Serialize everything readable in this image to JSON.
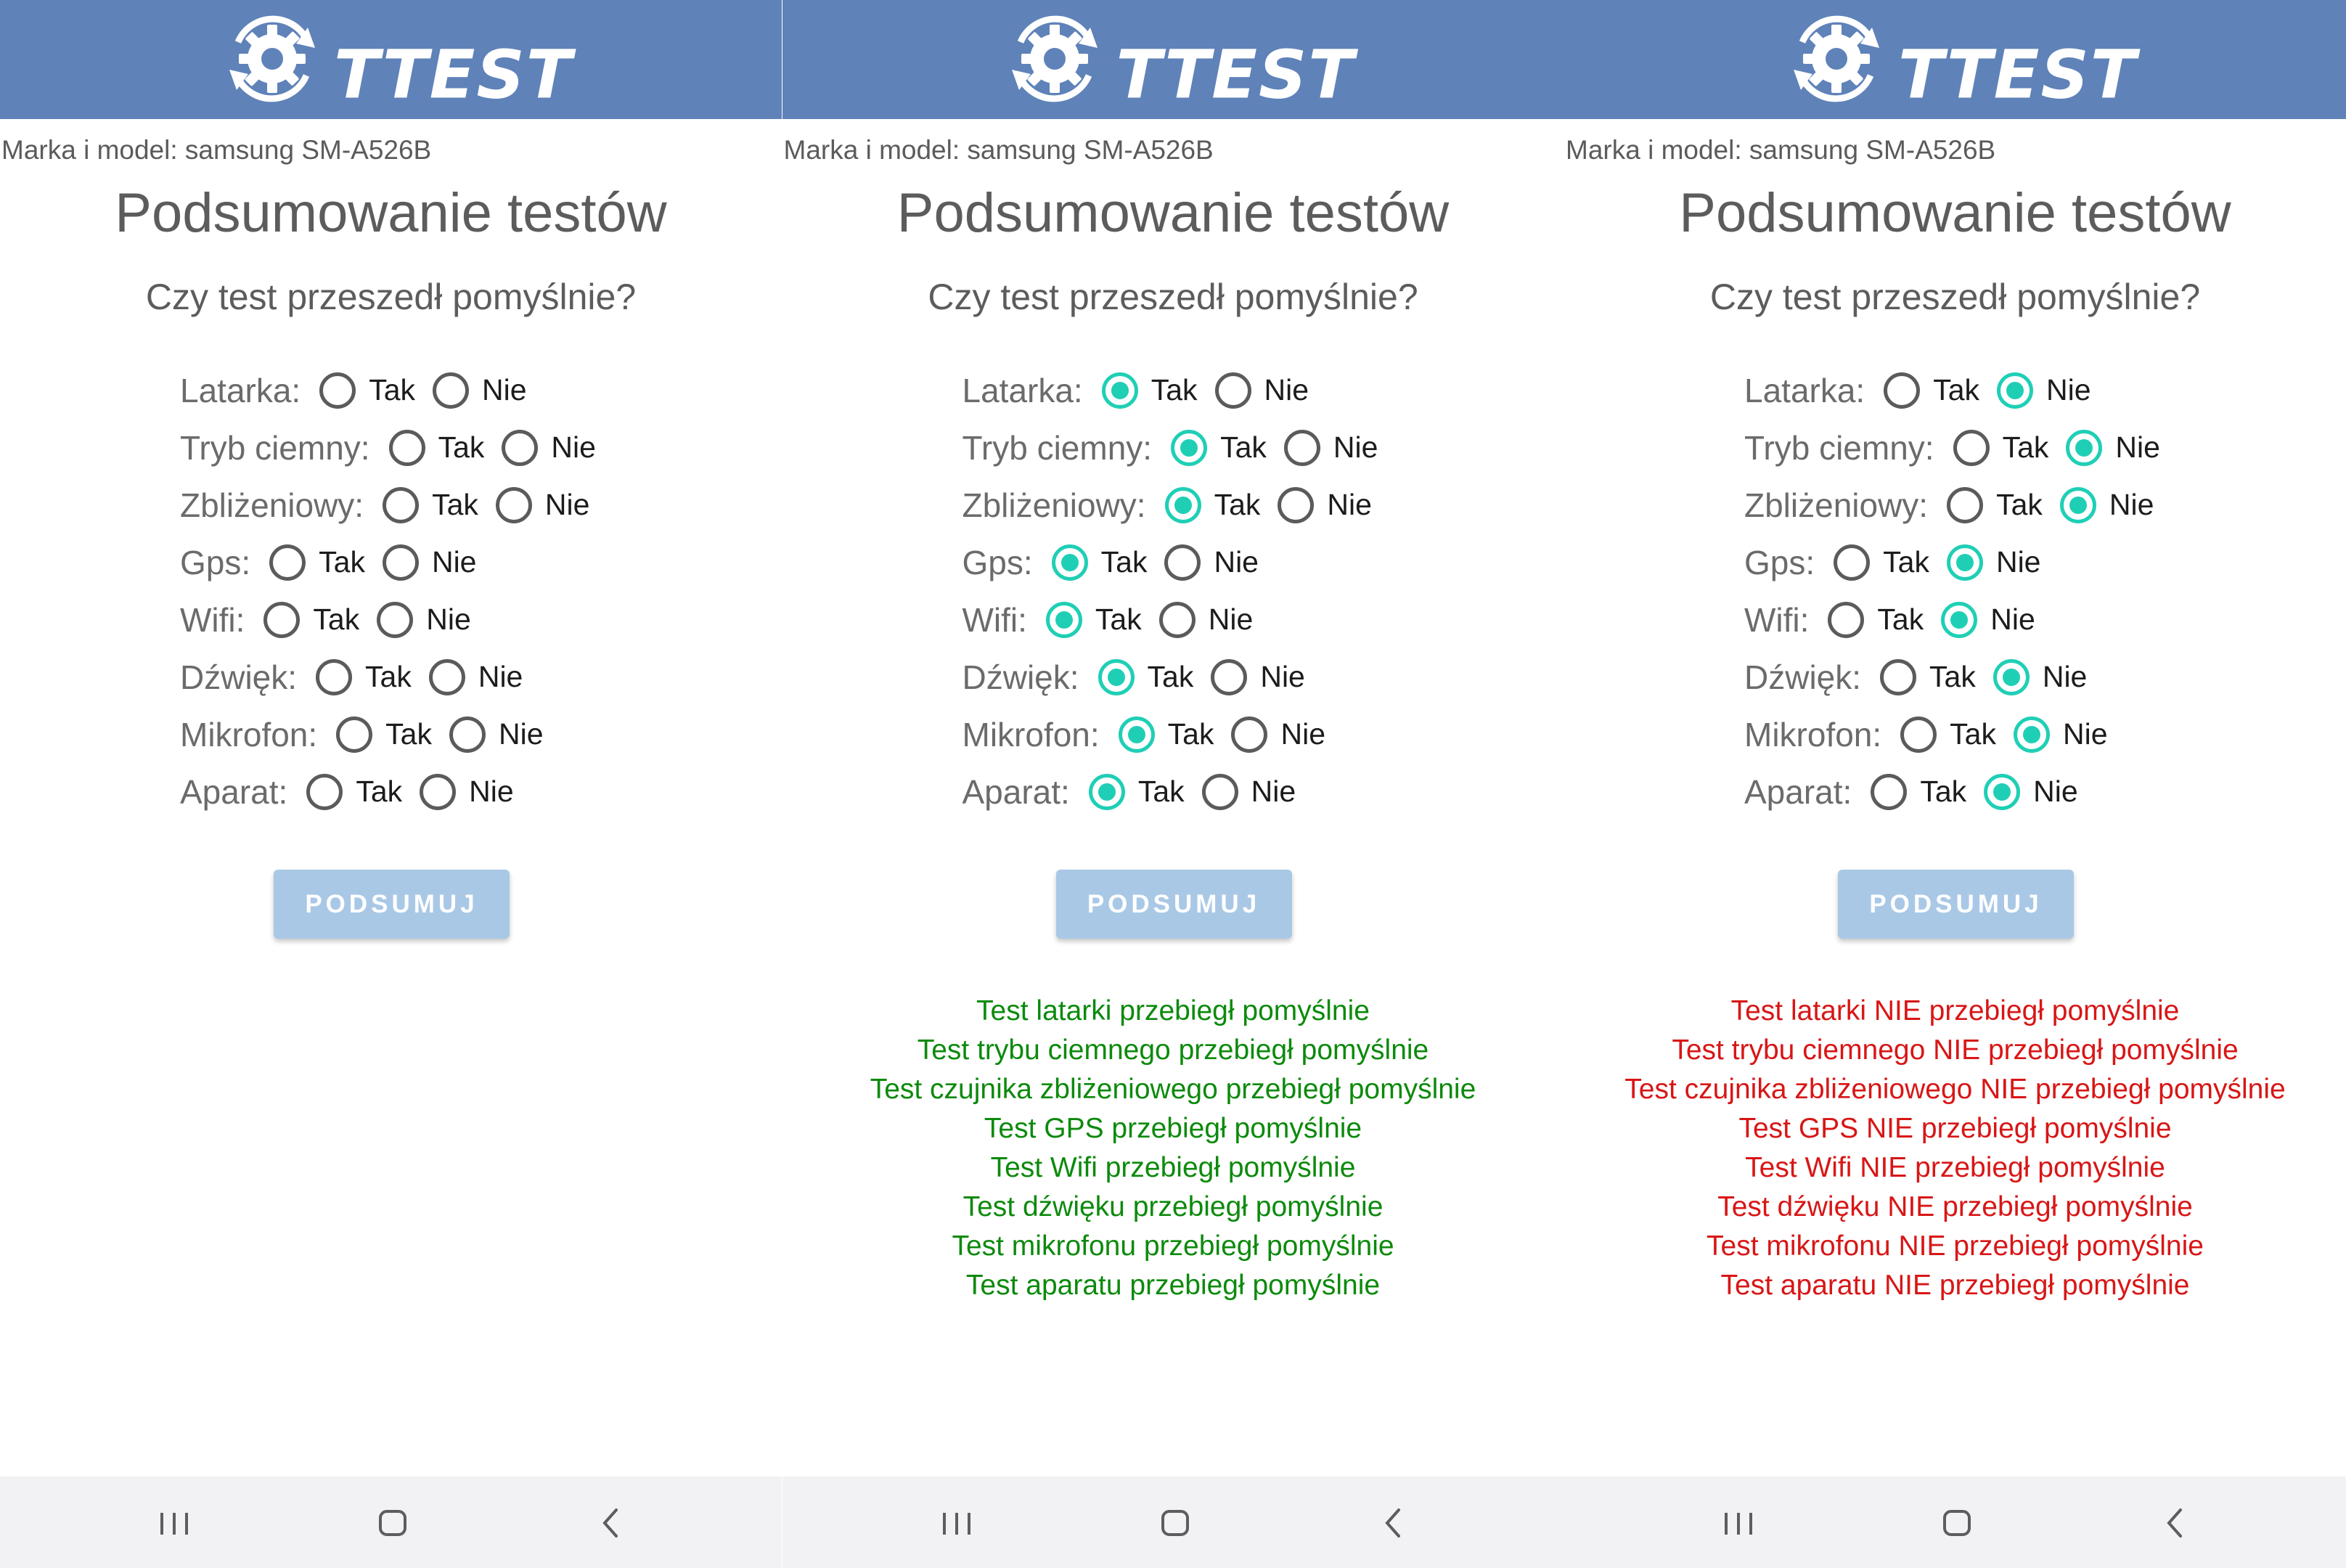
{
  "app": {
    "brand_text": "TTEST",
    "device_info": "Marka i model: samsung SM-A526B",
    "title": "Podsumowanie testów",
    "question": "Czy test przeszedł pomyślnie?",
    "option_yes": "Tak",
    "option_no": "Nie",
    "button_label": "PODSUMUJ"
  },
  "colors": {
    "appbar": "#5f82b9",
    "radio_checked": "#1fcfb5",
    "button": "#a9c8e6",
    "success": "#0c8a0c",
    "failure": "#d81616"
  },
  "tests": [
    {
      "key": "latarka",
      "label": "Latarka:"
    },
    {
      "key": "tryb",
      "label": "Tryb ciemny:"
    },
    {
      "key": "zblizeniowy",
      "label": "Zbliżeniowy:"
    },
    {
      "key": "gps",
      "label": "Gps:"
    },
    {
      "key": "wifi",
      "label": "Wifi:"
    },
    {
      "key": "dzwiek",
      "label": "Dźwięk:"
    },
    {
      "key": "mikrofon",
      "label": "Mikrofon:"
    },
    {
      "key": "aparat",
      "label": "Aparat:"
    }
  ],
  "screens": [
    {
      "selection": [
        null,
        null,
        null,
        null,
        null,
        null,
        null,
        null
      ],
      "result_status": "none",
      "results": []
    },
    {
      "selection": [
        "Tak",
        "Tak",
        "Tak",
        "Tak",
        "Tak",
        "Tak",
        "Tak",
        "Tak"
      ],
      "result_status": "success",
      "results": [
        "Test latarki przebiegł pomyślnie",
        "Test trybu ciemnego przebiegł pomyślnie",
        "Test czujnika zbliżeniowego przebiegł pomyślnie",
        "Test GPS przebiegł pomyślnie",
        "Test Wifi przebiegł pomyślnie",
        "Test dźwięku przebiegł pomyślnie",
        "Test mikrofonu przebiegł pomyślnie",
        "Test aparatu przebiegł pomyślnie"
      ]
    },
    {
      "selection": [
        "Nie",
        "Nie",
        "Nie",
        "Nie",
        "Nie",
        "Nie",
        "Nie",
        "Nie"
      ],
      "result_status": "failure",
      "results": [
        "Test latarki NIE przebiegł pomyślnie",
        "Test trybu ciemnego NIE przebiegł pomyślnie",
        "Test czujnika zbliżeniowego NIE przebiegł pomyślnie",
        "Test GPS NIE przebiegł pomyślnie",
        "Test Wifi NIE przebiegł pomyślnie",
        "Test dźwięku NIE przebiegł pomyślnie",
        "Test mikrofonu NIE przebiegł pomyślnie",
        "Test aparatu NIE przebiegł pomyślnie"
      ]
    }
  ],
  "navbar": {
    "icons": [
      "recent-apps-icon",
      "home-icon",
      "back-icon"
    ]
  }
}
